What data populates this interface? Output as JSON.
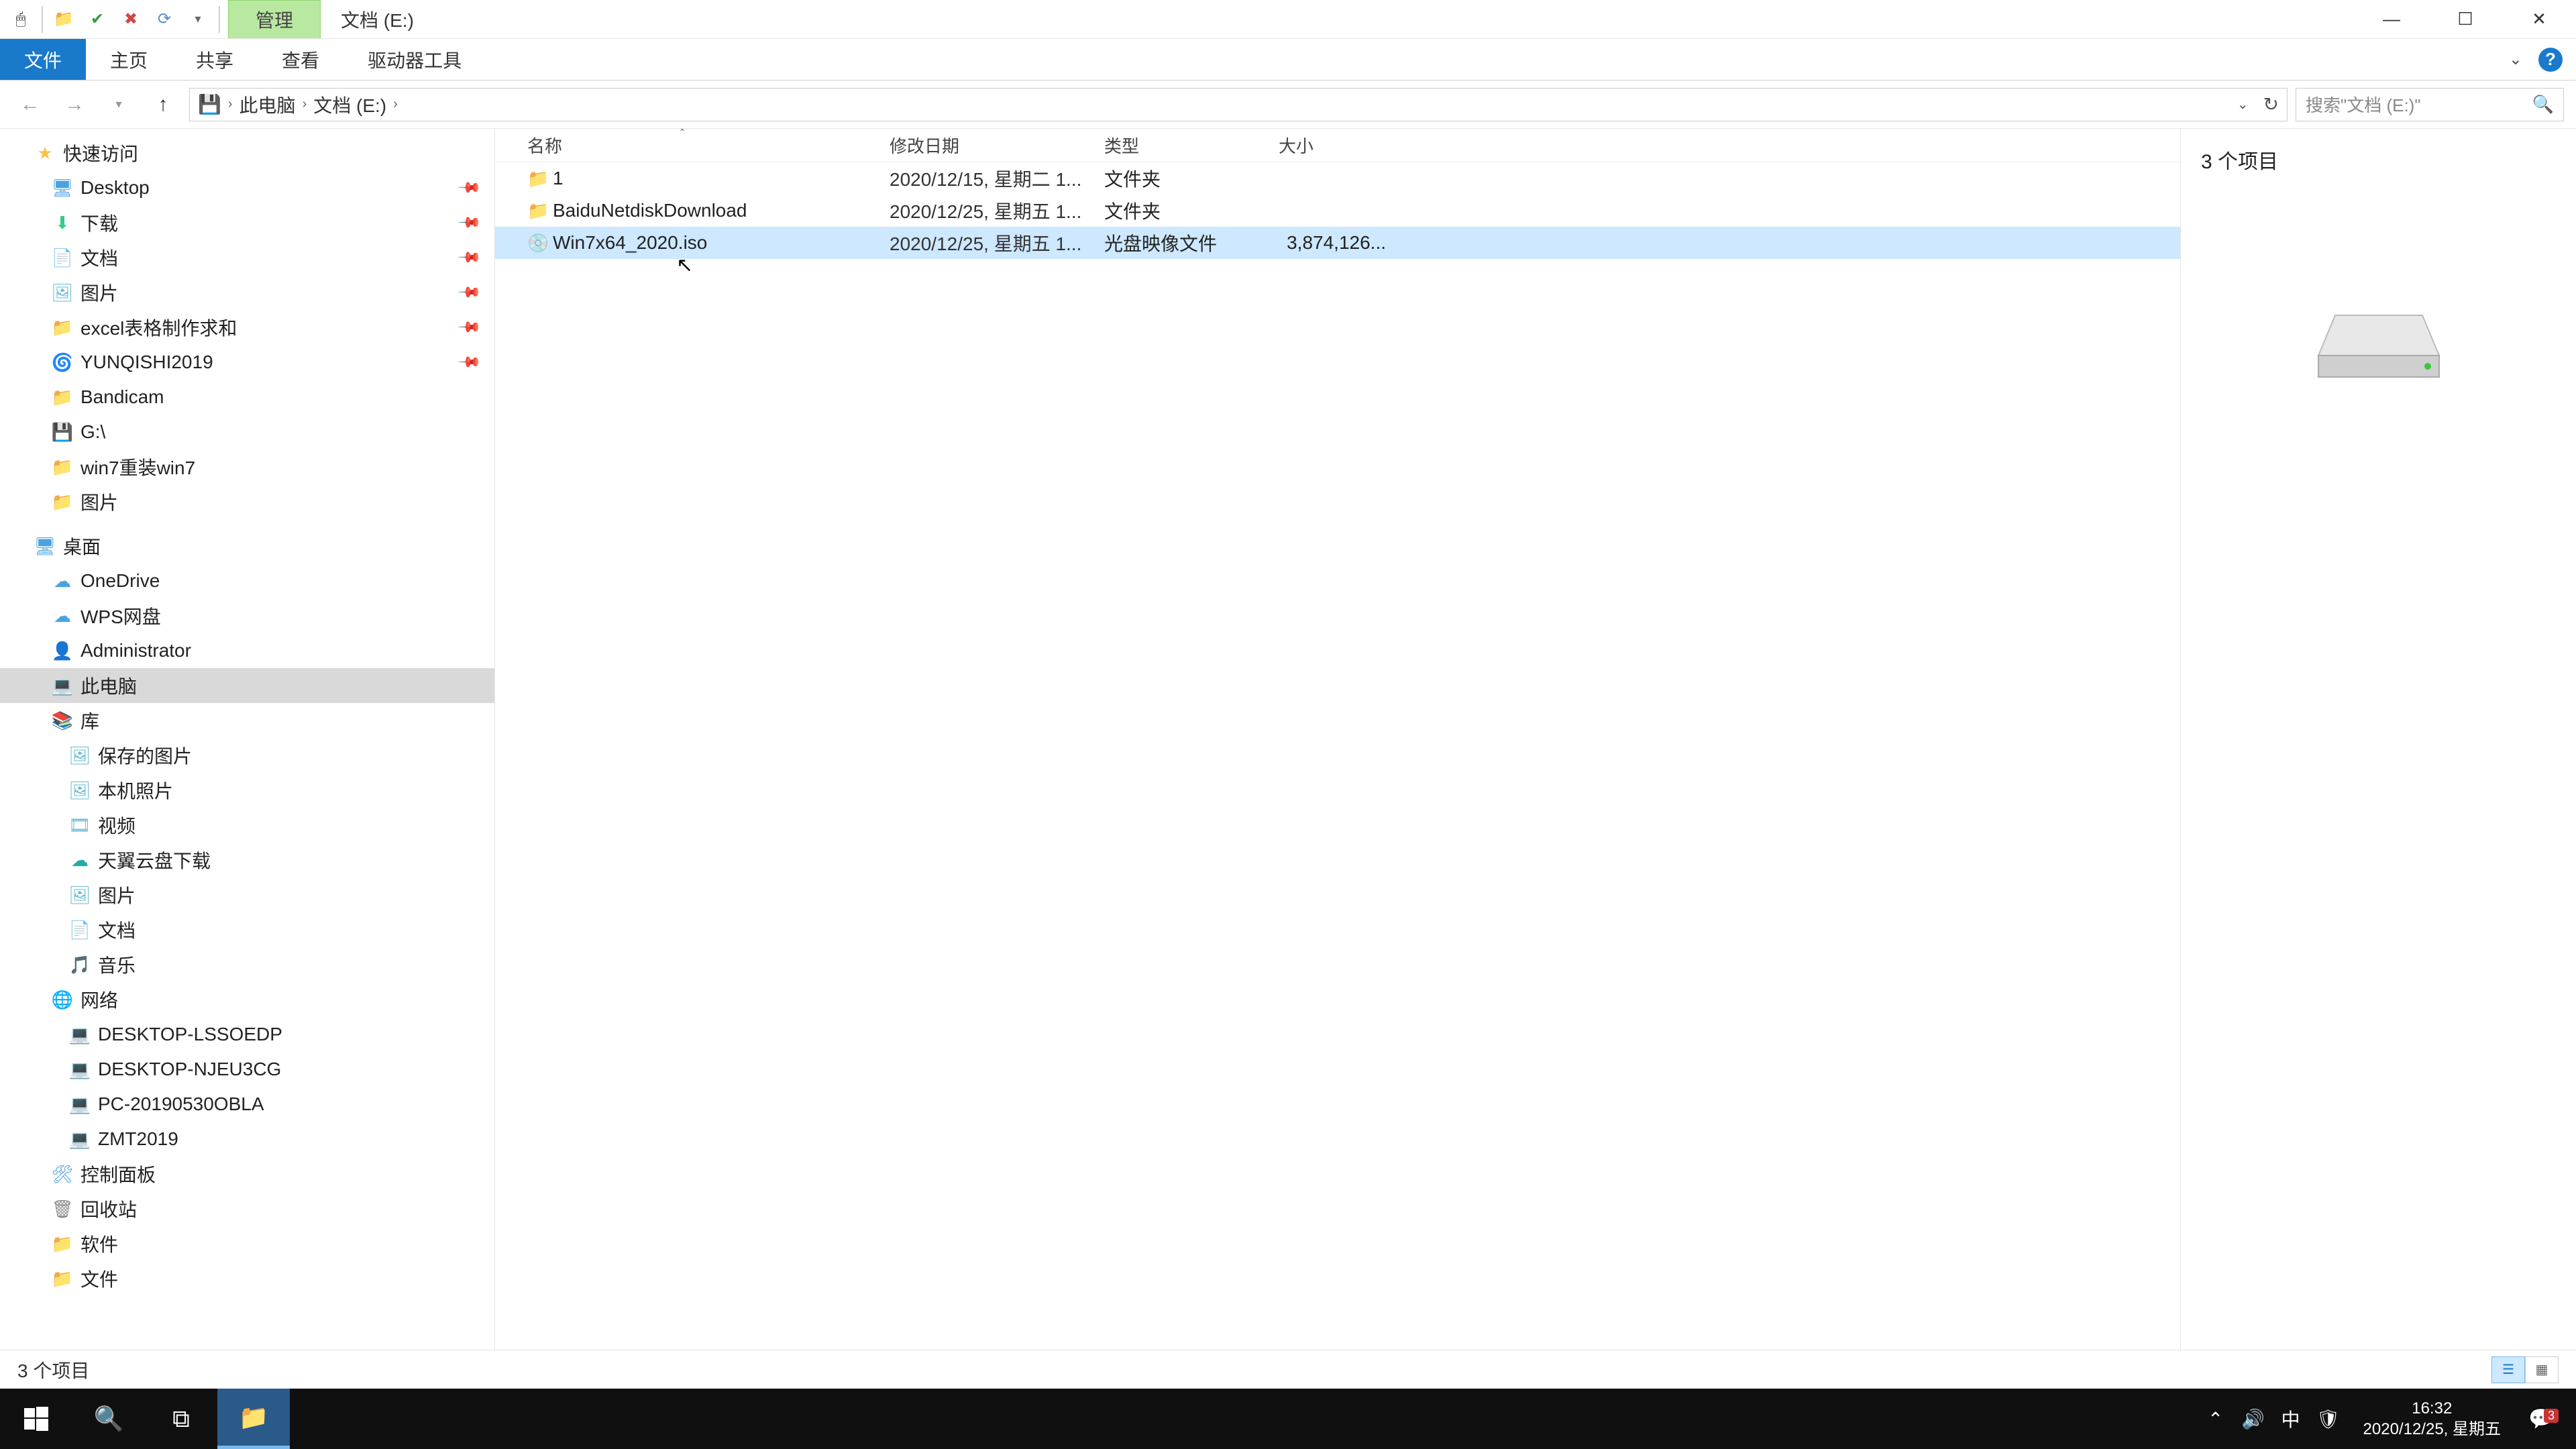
{
  "titlebar": {
    "qat_manage": "管理",
    "path_title": "文档 (E:)"
  },
  "ribbon": {
    "file": "文件",
    "home": "主页",
    "share": "共享",
    "view": "查看",
    "drive": "驱动器工具"
  },
  "address": {
    "pc": "此电脑",
    "drive": "文档 (E:)"
  },
  "search": {
    "placeholder": "搜索\"文档 (E:)\""
  },
  "columns": {
    "name": "名称",
    "date": "修改日期",
    "type": "类型",
    "size": "大小"
  },
  "files": [
    {
      "icon": "📁",
      "icls": "c-folder",
      "name": "1",
      "date": "2020/12/15, 星期二 1...",
      "type": "文件夹",
      "size": ""
    },
    {
      "icon": "📁",
      "icls": "c-folder",
      "name": "BaiduNetdiskDownload",
      "date": "2020/12/25, 星期五 1...",
      "type": "文件夹",
      "size": ""
    },
    {
      "icon": "💿",
      "icls": "c-iso",
      "name": "Win7x64_2020.iso",
      "date": "2020/12/25, 星期五 1...",
      "type": "光盘映像文件",
      "size": "3,874,126...",
      "selected": true
    }
  ],
  "preview": {
    "count_label": "3 个项目"
  },
  "status": {
    "text": "3 个项目"
  },
  "tree_quick": {
    "title": "快速访问",
    "items": [
      {
        "icon": "🖥",
        "icls": "c-blue",
        "label": "Desktop",
        "pin": true
      },
      {
        "icon": "⬇",
        "icls": "c-dl",
        "label": "下载",
        "pin": true
      },
      {
        "icon": "📄",
        "icls": "c-doc",
        "label": "文档",
        "pin": true
      },
      {
        "icon": "🖼",
        "icls": "c-pic",
        "label": "图片",
        "pin": true
      },
      {
        "icon": "📁",
        "icls": "c-folder",
        "label": "excel表格制作求和",
        "pin": true
      },
      {
        "icon": "🌀",
        "icls": "c-blue",
        "label": "YUNQISHI2019",
        "pin": true
      },
      {
        "icon": "📁",
        "icls": "c-folder",
        "label": "Bandicam"
      },
      {
        "icon": "💾",
        "icls": "c-blue",
        "label": "G:\\"
      },
      {
        "icon": "📁",
        "icls": "c-folder",
        "label": "win7重装win7"
      },
      {
        "icon": "📁",
        "icls": "c-folder",
        "label": "图片"
      }
    ]
  },
  "tree_desktop": {
    "title": "桌面",
    "items": [
      {
        "icon": "☁",
        "icls": "c-blue",
        "label": "OneDrive"
      },
      {
        "icon": "☁",
        "icls": "c-blue",
        "label": "WPS网盘"
      },
      {
        "icon": "👤",
        "icls": "c-folder",
        "label": "Administrator"
      },
      {
        "icon": "💻",
        "icls": "c-pc",
        "label": "此电脑",
        "selected": true
      },
      {
        "icon": "📚",
        "icls": "c-folder",
        "label": "库"
      }
    ],
    "lib_items": [
      {
        "icon": "🖼",
        "icls": "c-pic",
        "label": "保存的图片"
      },
      {
        "icon": "🖼",
        "icls": "c-pic",
        "label": "本机照片"
      },
      {
        "icon": "🎞",
        "icls": "c-pic",
        "label": "视频"
      },
      {
        "icon": "☁",
        "icls": "c-teal",
        "label": "天翼云盘下载"
      },
      {
        "icon": "🖼",
        "icls": "c-pic",
        "label": "图片"
      },
      {
        "icon": "📄",
        "icls": "c-doc",
        "label": "文档"
      },
      {
        "icon": "🎵",
        "icls": "c-pic",
        "label": "音乐"
      }
    ],
    "network_label": "网络",
    "net_items": [
      {
        "icon": "💻",
        "icls": "c-pc",
        "label": "DESKTOP-LSSOEDP"
      },
      {
        "icon": "💻",
        "icls": "c-pc",
        "label": "DESKTOP-NJEU3CG"
      },
      {
        "icon": "💻",
        "icls": "c-pc",
        "label": "PC-20190530OBLA"
      },
      {
        "icon": "💻",
        "icls": "c-pc",
        "label": "ZMT2019"
      }
    ],
    "extra": [
      {
        "icon": "🛠",
        "icls": "c-blue",
        "label": "控制面板"
      },
      {
        "icon": "🗑",
        "icls": "c-drive",
        "label": "回收站"
      },
      {
        "icon": "📁",
        "icls": "c-folder",
        "label": "软件"
      },
      {
        "icon": "📁",
        "icls": "c-folder",
        "label": "文件"
      }
    ]
  },
  "taskbar": {
    "time": "16:32",
    "date": "2020/12/25, 星期五",
    "ime": "中",
    "notif_count": "3"
  }
}
